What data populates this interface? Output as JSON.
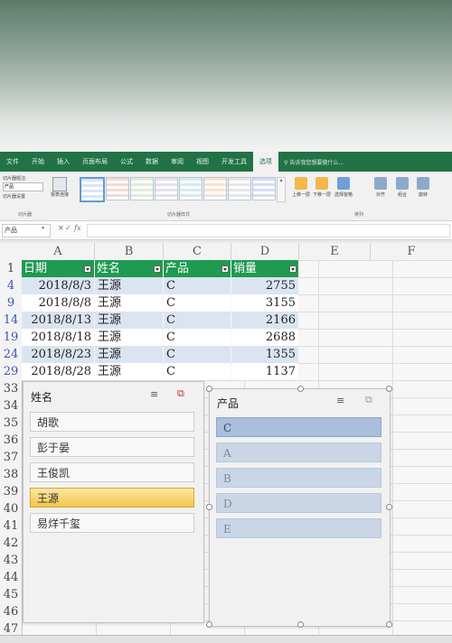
{
  "ribbon": {
    "tabs": [
      "文件",
      "开始",
      "插入",
      "页面布局",
      "公式",
      "数据",
      "审阅",
      "视图",
      "开发工具",
      "选项"
    ],
    "active_tab": "选项",
    "tell_me": "告诉我您想要做什么...",
    "groups": {
      "slicer": "切片器",
      "slicer_styles": "切片器样式",
      "arrange": "排列"
    },
    "slicer_caption_label": "切片器题注:",
    "slicer_caption_value": "产品",
    "slicer_settings": "切片器设置",
    "report_connections": "报表连接",
    "arrange_buttons": [
      "上移一层",
      "下移一层",
      "选择窗格",
      "对齐",
      "组合",
      "旋转"
    ]
  },
  "formula_bar": {
    "name_box": "产品",
    "fx": "fx"
  },
  "columns": [
    "A",
    "B",
    "C",
    "D",
    "E",
    "F"
  ],
  "row_numbers": [
    "1",
    "4",
    "9",
    "14",
    "19",
    "24",
    "29",
    "33",
    "34",
    "35",
    "36",
    "37",
    "38",
    "39",
    "40",
    "41",
    "42",
    "43",
    "44",
    "45",
    "46",
    "47"
  ],
  "table": {
    "headers": [
      "日期",
      "姓名",
      "产品",
      "销量"
    ],
    "rows": [
      [
        "2018/8/3",
        "王源",
        "C",
        "2755"
      ],
      [
        "2018/8/8",
        "王源",
        "C",
        "3155"
      ],
      [
        "2018/8/13",
        "王源",
        "C",
        "2166"
      ],
      [
        "2018/8/18",
        "王源",
        "C",
        "2688"
      ],
      [
        "2018/8/23",
        "王源",
        "C",
        "1355"
      ],
      [
        "2018/8/28",
        "王源",
        "C",
        "1137"
      ]
    ]
  },
  "slicer_name": {
    "title": "姓名",
    "items": [
      "胡歌",
      "彭于晏",
      "王俊凯",
      "王源",
      "易烊千玺"
    ],
    "selected": "王源"
  },
  "slicer_product": {
    "title": "产品",
    "items": [
      "C",
      "A",
      "B",
      "D",
      "E"
    ],
    "selected": "C"
  },
  "colors": {
    "excel_green": "#217346",
    "table_header": "#1f9a50",
    "band": "#dbe5f1",
    "slicer_selected": "#f4c54a",
    "product_selected": "#a9bfdc"
  }
}
